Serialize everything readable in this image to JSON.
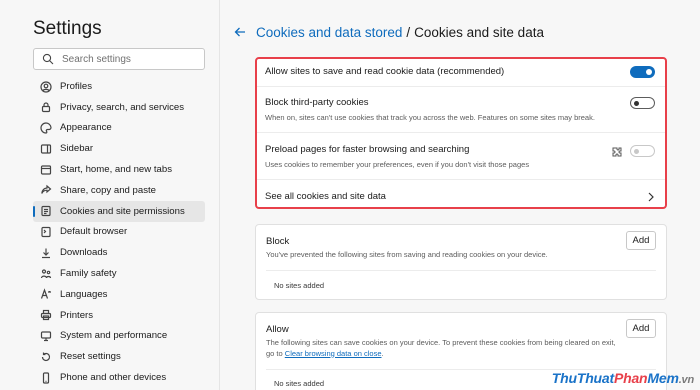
{
  "sidebar": {
    "title": "Settings",
    "search_placeholder": "Search settings",
    "items": [
      {
        "label": "Profiles",
        "icon": "profile-icon"
      },
      {
        "label": "Privacy, search, and services",
        "icon": "lock-icon"
      },
      {
        "label": "Appearance",
        "icon": "palette-icon"
      },
      {
        "label": "Sidebar",
        "icon": "sidebar-icon"
      },
      {
        "label": "Start, home, and new tabs",
        "icon": "power-icon"
      },
      {
        "label": "Share, copy and paste",
        "icon": "share-icon"
      },
      {
        "label": "Cookies and site permissions",
        "icon": "cookie-permissions-icon",
        "active": true
      },
      {
        "label": "Default browser",
        "icon": "browser-icon"
      },
      {
        "label": "Downloads",
        "icon": "download-icon"
      },
      {
        "label": "Family safety",
        "icon": "family-icon"
      },
      {
        "label": "Languages",
        "icon": "language-icon"
      },
      {
        "label": "Printers",
        "icon": "printer-icon"
      },
      {
        "label": "System and performance",
        "icon": "system-icon"
      },
      {
        "label": "Reset settings",
        "icon": "reset-icon"
      },
      {
        "label": "Phone and other devices",
        "icon": "phone-icon"
      }
    ]
  },
  "breadcrumb": {
    "parent": "Cookies and data stored",
    "separator": "/",
    "current": "Cookies and site data"
  },
  "settings": {
    "allow_sites": {
      "title": "Allow sites to save and read cookie data (recommended)",
      "state": "on"
    },
    "block_third_party": {
      "title": "Block third-party cookies",
      "desc": "When on, sites can't use cookies that track you across the web. Features on some sites may break.",
      "state": "off"
    },
    "preload": {
      "title": "Preload pages for faster browsing and searching",
      "desc": "Uses cookies to remember your preferences, even if you don't visit those pages",
      "state": "disabled"
    },
    "see_all": {
      "title": "See all cookies and site data"
    }
  },
  "block": {
    "title": "Block",
    "desc": "You've prevented the following sites from saving and reading cookies on your device.",
    "add_label": "Add",
    "empty": "No sites added"
  },
  "allow": {
    "title": "Allow",
    "desc": "The following sites can save cookies on your device. To prevent these cookies from being cleared on exit, go to",
    "link": "Clear browsing data on close",
    "link_suffix": ".",
    "add_label": "Add",
    "empty": "No sites added"
  },
  "colors": {
    "accent": "#0f6cbd",
    "highlight_border": "#e8404a"
  },
  "watermark": {
    "part1": "ThuThuat",
    "part2": "Phan",
    "part3": "Mem",
    "part4": ".vn"
  }
}
